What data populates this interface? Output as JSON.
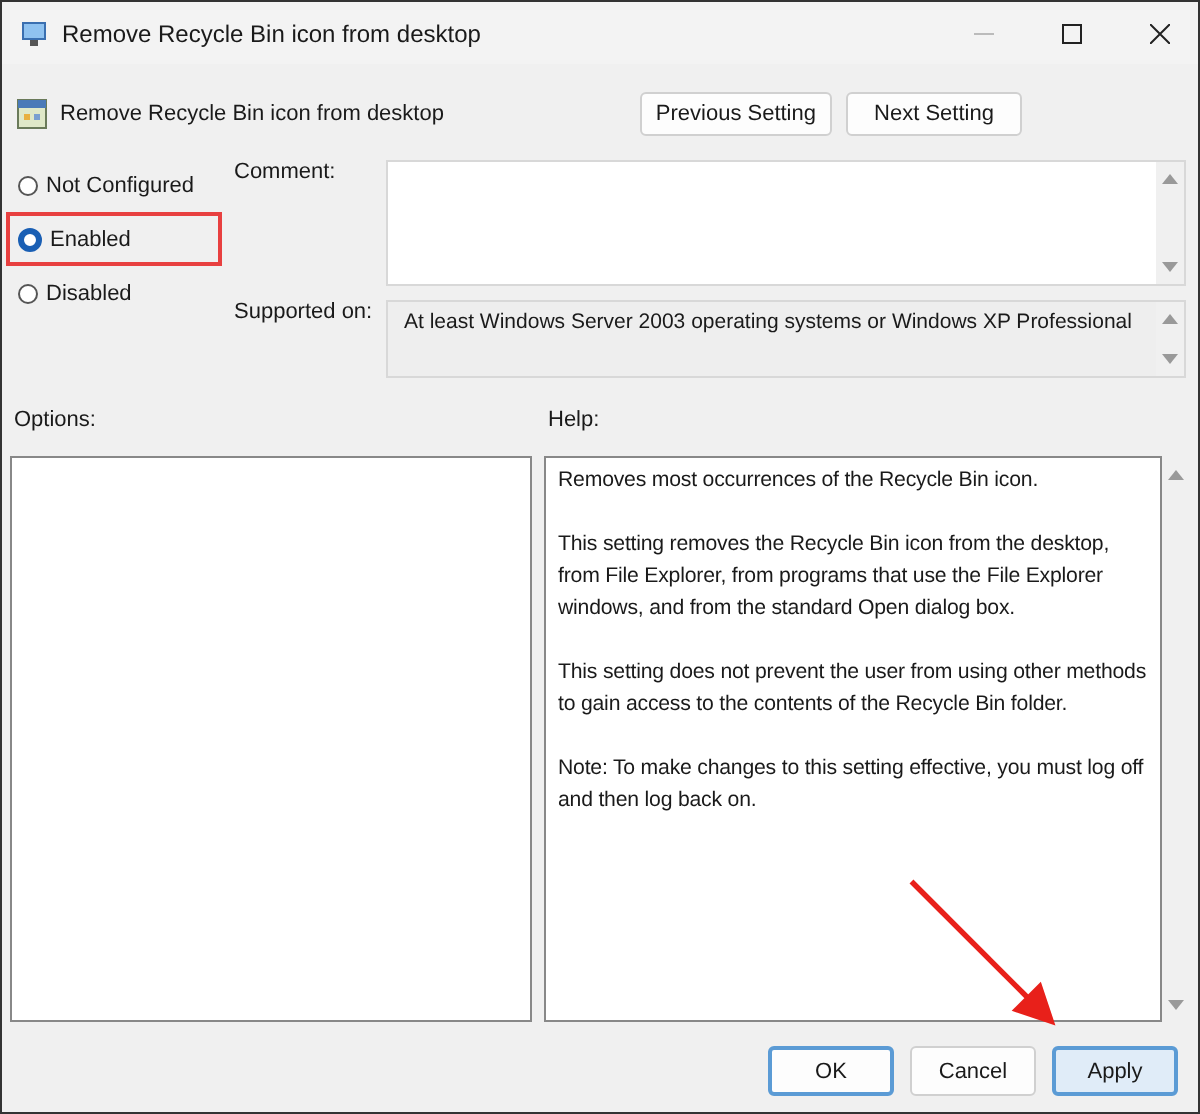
{
  "window": {
    "title": "Remove Recycle Bin icon from desktop"
  },
  "header": {
    "title": "Remove Recycle Bin icon from desktop",
    "buttons": [
      "Previous Setting",
      "Next Setting"
    ]
  },
  "states": [
    {
      "label": "Not Configured",
      "selected": false,
      "highlighted": false
    },
    {
      "label": "Enabled",
      "selected": true,
      "highlighted": true
    },
    {
      "label": "Disabled",
      "selected": false,
      "highlighted": false
    }
  ],
  "comment": {
    "label": "Comment:"
  },
  "supported_on": {
    "label": "Supported on:",
    "value": "At least Windows Server 2003 operating systems or Windows XP Professional"
  },
  "options": {
    "label": "Options:"
  },
  "help": {
    "label": "Help:",
    "paragraphs": [
      "Removes most occurrences of the Recycle Bin icon.",
      "This setting removes the Recycle Bin icon from the desktop, from File Explorer, from programs that use the File Explorer windows, and from the standard Open dialog box.",
      "This setting does not prevent the user from using other methods to gain access to the contents of the Recycle Bin folder.",
      "Note: To make changes to this setting effective, you must log off and then log back on."
    ]
  },
  "footer_buttons": [
    {
      "label": "OK",
      "default": true,
      "hover": false
    },
    {
      "label": "Cancel",
      "default": false,
      "hover": false
    },
    {
      "label": "Apply",
      "default": false,
      "hover": true
    }
  ]
}
